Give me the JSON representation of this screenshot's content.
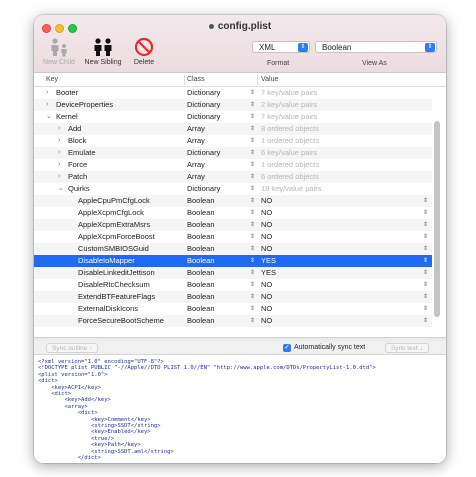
{
  "window": {
    "title": "config.plist"
  },
  "toolbar": {
    "new_child": "New Child",
    "new_sibling": "New Sibling",
    "delete": "Delete",
    "format_value": "XML",
    "format_label": "Format",
    "view_value": "Boolean",
    "view_label": "View As"
  },
  "table": {
    "headers": {
      "key": "Key",
      "class": "Class",
      "value": "Value"
    },
    "rows": [
      {
        "key": "Booter",
        "class": "Dictionary",
        "value": "7 key/value pairs",
        "disc": "›",
        "depth": 0,
        "placeholder": true
      },
      {
        "key": "DeviceProperties",
        "class": "Dictionary",
        "value": "2 key/value pairs",
        "disc": "›",
        "depth": 0,
        "placeholder": true
      },
      {
        "key": "Kernel",
        "class": "Dictionary",
        "value": "7 key/value pairs",
        "disc": "⌄",
        "depth": 0,
        "placeholder": true
      },
      {
        "key": "Add",
        "class": "Array",
        "value": "8 ordered objects",
        "disc": "›",
        "depth": 1,
        "placeholder": true
      },
      {
        "key": "Block",
        "class": "Array",
        "value": "1 ordered objects",
        "disc": "›",
        "depth": 1,
        "placeholder": true
      },
      {
        "key": "Emulate",
        "class": "Dictionary",
        "value": "6 key/value pairs",
        "disc": "›",
        "depth": 1,
        "placeholder": true
      },
      {
        "key": "Force",
        "class": "Array",
        "value": "1 ordered objects",
        "disc": "›",
        "depth": 1,
        "placeholder": true
      },
      {
        "key": "Patch",
        "class": "Array",
        "value": "6 ordered objects",
        "disc": "›",
        "depth": 1,
        "placeholder": true
      },
      {
        "key": "Quirks",
        "class": "Dictionary",
        "value": "18 key/value pairs",
        "disc": "⌄",
        "depth": 1,
        "placeholder": true
      },
      {
        "key": "AppleCpuPmCfgLock",
        "class": "Boolean",
        "value": "NO",
        "disc": "",
        "depth": 2,
        "placeholder": false
      },
      {
        "key": "AppleXcpmCfgLock",
        "class": "Boolean",
        "value": "NO",
        "disc": "",
        "depth": 2,
        "placeholder": false
      },
      {
        "key": "AppleXcpmExtraMsrs",
        "class": "Boolean",
        "value": "NO",
        "disc": "",
        "depth": 2,
        "placeholder": false
      },
      {
        "key": "AppleXcpmForceBoost",
        "class": "Boolean",
        "value": "NO",
        "disc": "",
        "depth": 2,
        "placeholder": false
      },
      {
        "key": "CustomSMBIOSGuid",
        "class": "Boolean",
        "value": "NO",
        "disc": "",
        "depth": 2,
        "placeholder": false
      },
      {
        "key": "DisableIoMapper",
        "class": "Boolean",
        "value": "YES",
        "disc": "",
        "depth": 2,
        "placeholder": false,
        "selected": true
      },
      {
        "key": "DisableLinkeditJettison",
        "class": "Boolean",
        "value": "YES",
        "disc": "",
        "depth": 2,
        "placeholder": false
      },
      {
        "key": "DisableRtcChecksum",
        "class": "Boolean",
        "value": "NO",
        "disc": "",
        "depth": 2,
        "placeholder": false
      },
      {
        "key": "ExtendBTFeatureFlags",
        "class": "Boolean",
        "value": "NO",
        "disc": "",
        "depth": 2,
        "placeholder": false
      },
      {
        "key": "ExternalDiskIcons",
        "class": "Boolean",
        "value": "NO",
        "disc": "",
        "depth": 2,
        "placeholder": false
      },
      {
        "key": "ForceSecureBootScheme",
        "class": "Boolean",
        "value": "NO",
        "disc": "",
        "depth": 2,
        "placeholder": false
      }
    ]
  },
  "sync": {
    "sync_outline": "Sync outline ↑",
    "auto_sync_label": "Automatically sync text",
    "auto_sync_checked": true,
    "sync_text": "Sync text ↓"
  },
  "xml_lines": [
    "<?xml version=\"1.0\" encoding=\"UTF-8\"?>",
    "<!DOCTYPE plist PUBLIC \"-//Apple//DTD PLIST 1.0//EN\" \"http://www.apple.com/DTDs/PropertyList-1.0.dtd\">",
    "<plist version=\"1.0\">",
    "<dict>",
    "    <key>ACPI</key>",
    "    <dict>",
    "        <key>Add</key>",
    "        <array>",
    "            <dict>",
    "                <key>Comment</key>",
    "                <string>SSDT</string>",
    "                <key>Enabled</key>",
    "                <true/>",
    "                <key>Path</key>",
    "                <string>SSDT.aml</string>",
    "            </dict>"
  ],
  "colors": {
    "selection": "#1f6af0",
    "accent": "#2f7bf5",
    "delete_red": "#d9322e"
  }
}
